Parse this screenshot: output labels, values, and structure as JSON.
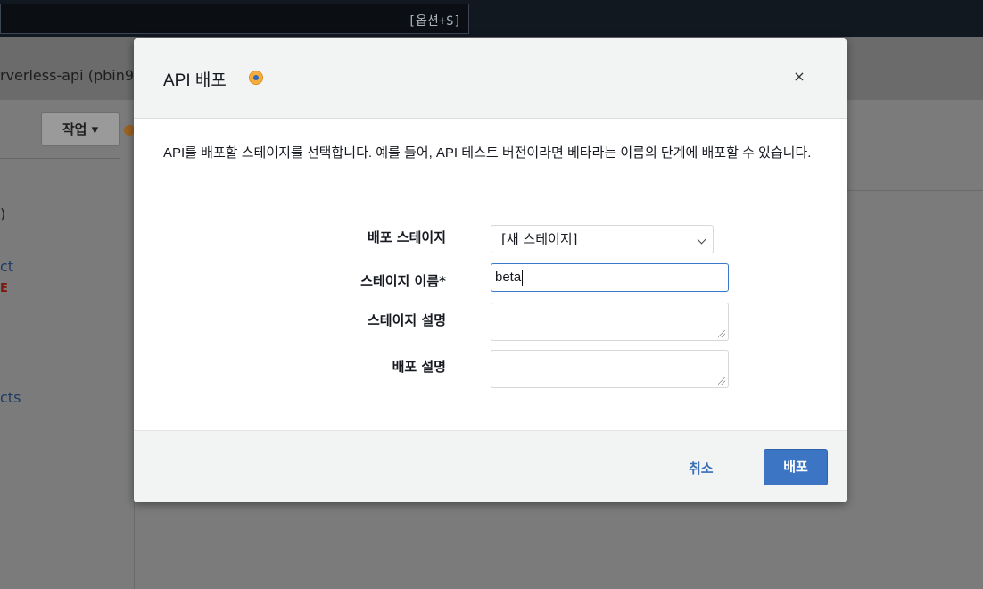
{
  "background": {
    "topbar_shortcut": "[옵션+S]",
    "api_title": "rverless-api (pbin9",
    "actions_label": "작업 ▾",
    "sidebar": {
      "paren": ")",
      "ct": "ct",
      "e": "E",
      "cts": "cts"
    }
  },
  "modal": {
    "title": "API 배포",
    "close": "×",
    "description": "API를 배포할 스테이지를 선택합니다. 예를 들어, API 테스트 버전이라면 베타라는 이름의 단계에 배포할 수 있습니다.",
    "fields": {
      "stage_label": "배포 스테이지",
      "stage_value": "[새 스테이지]",
      "name_label": "스테이지 이름*",
      "name_value": "beta",
      "stage_desc_label": "스테이지 설명",
      "deploy_desc_label": "배포 설명"
    },
    "footer": {
      "cancel": "취소",
      "deploy": "배포"
    }
  },
  "colors": {
    "primary_button": "#3b75c4",
    "link": "#3b6fb6",
    "info_icon": "#f3ae3d",
    "focus_border": "#3a79c9"
  }
}
